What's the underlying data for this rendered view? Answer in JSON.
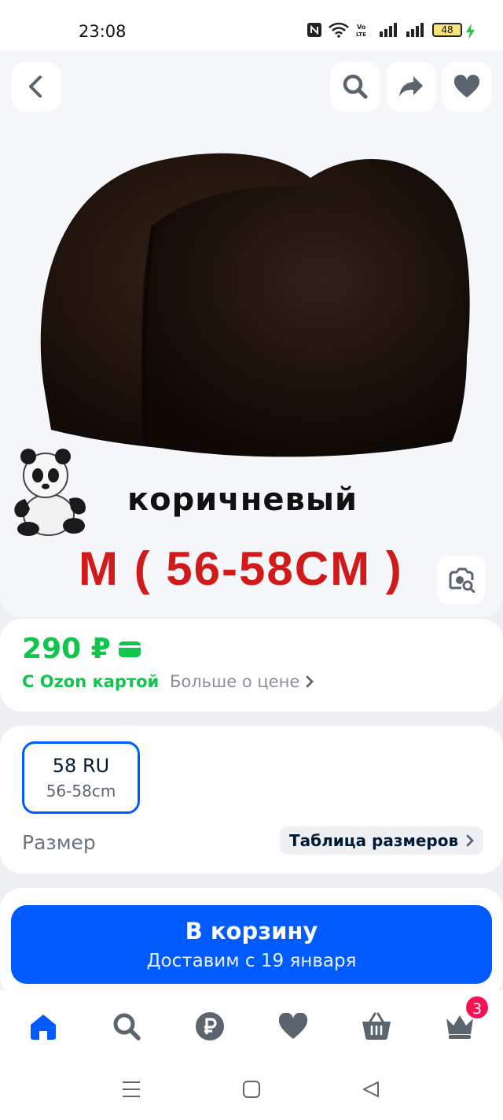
{
  "status_bar": {
    "time": "23:08",
    "battery_level": "48",
    "icons": [
      "nfc-icon",
      "wifi-icon",
      "volte-icon",
      "signal-icon",
      "signal-icon",
      "battery-icon",
      "charging-icon"
    ]
  },
  "hero": {
    "caption_color": "коричневый",
    "caption_size": "M ( 56-58CM )",
    "buttons": [
      "back-icon",
      "search-icon",
      "share-icon",
      "heart-icon"
    ]
  },
  "price": {
    "amount": "290 ₽",
    "ozon_card_label": "С Ozon картой",
    "more_label": "Больше о цене",
    "color": "#10c44c"
  },
  "size": {
    "selected_value": "58 RU",
    "selected_sub": "56-58cm",
    "label": "Размер",
    "table_label": "Таблица размеров"
  },
  "cart": {
    "title": "В корзину",
    "subtitle": "Доставим с 19 января",
    "color": "#005bff"
  },
  "tabbar": {
    "items": [
      "home-icon",
      "search-icon",
      "ruble-icon",
      "heart-icon",
      "basket-icon",
      "crown-icon"
    ],
    "active": "home-icon",
    "badge_count": "3"
  }
}
